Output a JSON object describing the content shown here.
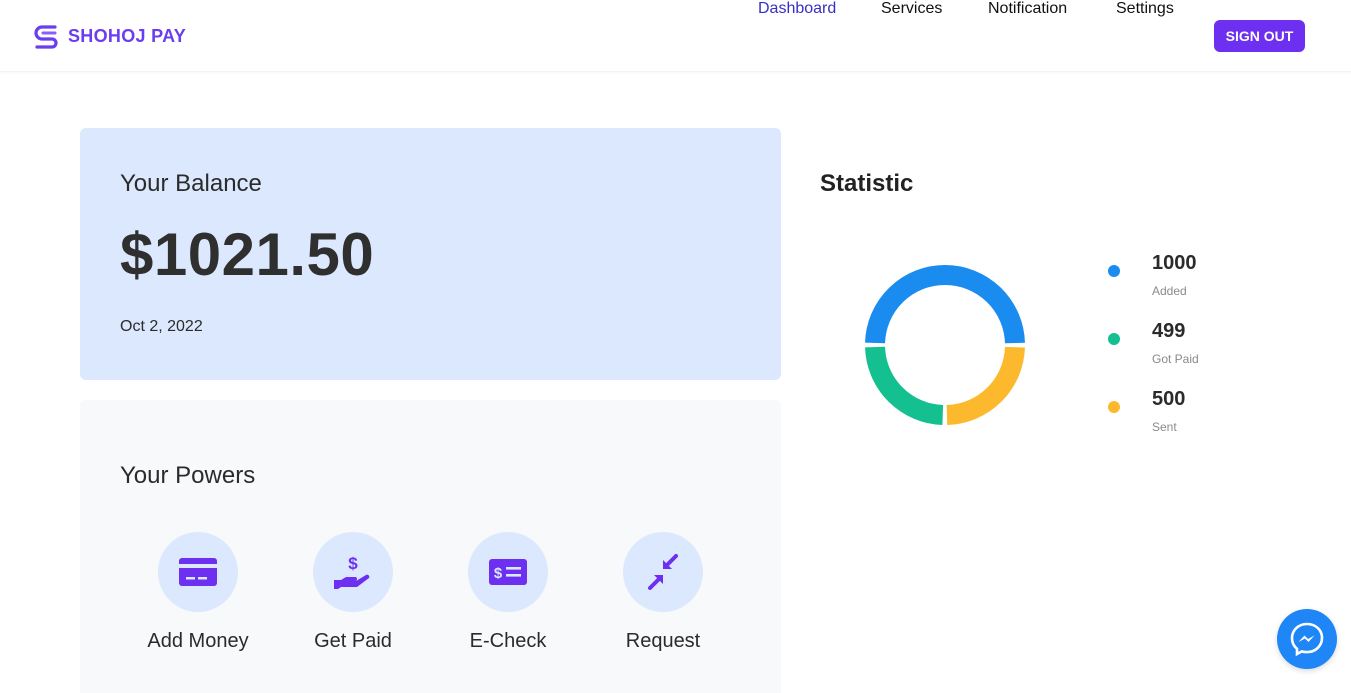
{
  "brand": {
    "name": "SHOHOJ PAY",
    "color": "#6a3df0"
  },
  "nav": {
    "items": [
      {
        "label": "Dashboard",
        "active": true
      },
      {
        "label": "Services",
        "active": false
      },
      {
        "label": "Notification",
        "active": false
      },
      {
        "label": "Settings",
        "active": false
      }
    ],
    "signout_label": "SIGN OUT"
  },
  "balance": {
    "title": "Your Balance",
    "amount": "$1021.50",
    "date": "Oct 2, 2022"
  },
  "powers": {
    "title": "Your Powers",
    "items": [
      {
        "label": "Add Money",
        "icon": "credit-card-icon"
      },
      {
        "label": "Get Paid",
        "icon": "hand-dollar-icon"
      },
      {
        "label": "E-Check",
        "icon": "check-dollar-icon"
      },
      {
        "label": "Request",
        "icon": "arrows-inward-icon"
      }
    ]
  },
  "statistic": {
    "title": "Statistic",
    "items": [
      {
        "value": "1000",
        "label": "Added",
        "color": "#1a8cf0"
      },
      {
        "value": "499",
        "label": "Got Paid",
        "color": "#14c08f"
      },
      {
        "value": "500",
        "label": "Sent",
        "color": "#fdb92e"
      }
    ]
  },
  "chart_data": {
    "type": "pie",
    "categories": [
      "Added",
      "Got Paid",
      "Sent"
    ],
    "values": [
      1000,
      499,
      500
    ],
    "colors": [
      "#1a8cf0",
      "#14c08f",
      "#fdb92e"
    ],
    "title": "Statistic",
    "legend": "right"
  },
  "colors": {
    "accent": "#6d2ff0",
    "nav_active": "#3730c7",
    "balance_bg": "#dbe8fd",
    "powers_bg": "#f8f9fb",
    "messenger": "#1e86f7"
  },
  "messenger": {
    "icon": "messenger-icon"
  }
}
